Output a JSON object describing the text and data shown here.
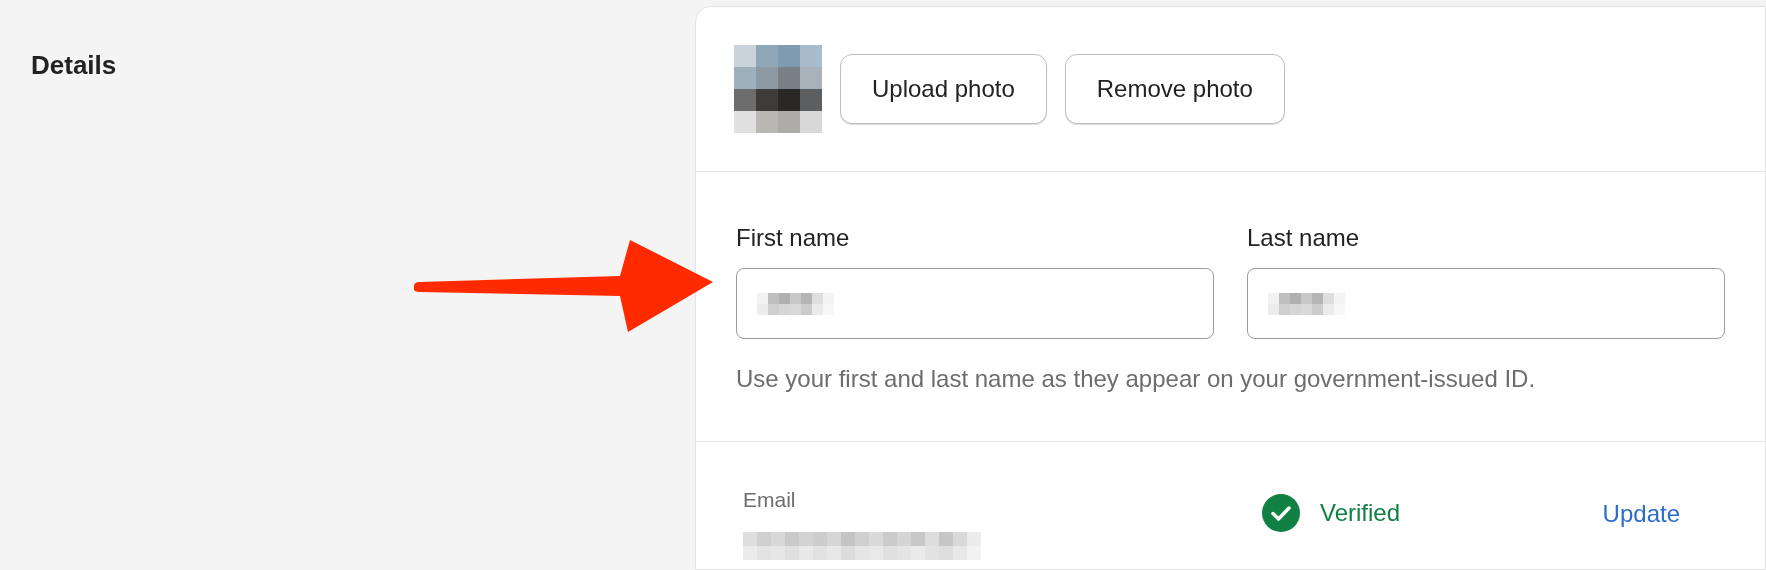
{
  "section": {
    "title": "Details"
  },
  "photo": {
    "kind": "picture",
    "buttons": [
      "Upload photo",
      "Remove photo"
    ]
  },
  "name_fields": [
    {
      "label": "First name"
    },
    {
      "label": "Last name"
    }
  ],
  "name_hint": "Use your first and last name as they appear on your government-issued ID.",
  "email": {
    "label": "Email",
    "verified": true,
    "status": "Verified",
    "action": "Update"
  }
}
